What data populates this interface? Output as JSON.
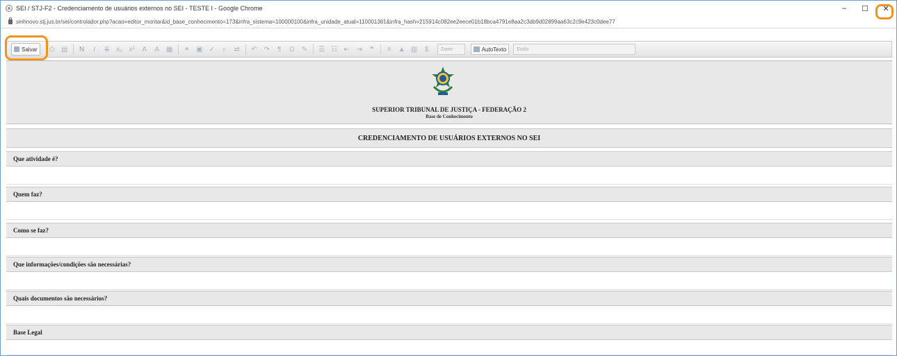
{
  "browser": {
    "title": "SEI / STJ-F2 - Credenciamento de usuários externos no SEI - TESTE I - Google Chrome",
    "url": "seihnovo.stj.jus.br/sei/controlador.php?acao=editor_montar&id_base_conhecimento=173&infra_sistema=100000100&infra_unidade_atual=110001381&infra_hash=215914c082ee2eece01b18bca4791e8aa2c3db9d02899aa63c2c9e423c0dee77",
    "controls": {
      "minimize": "–",
      "maximize": "☐",
      "close": "✕"
    }
  },
  "toolbar": {
    "save_label": "Salvar",
    "zoom_placeholder": "Zoom",
    "autotexto_label": "AutoTexto",
    "style_placeholder": "Estilo"
  },
  "document": {
    "org_name": "SUPERIOR TRIBUNAL DE JUSTIÇA - FEDERAÇÃO 2",
    "org_subtitle": "Base de Conhecimento",
    "title": "CREDENCIAMENTO DE USUÁRIOS EXTERNOS NO SEI",
    "sections": [
      {
        "label": "Que atividade é?"
      },
      {
        "label": "Quem faz?"
      },
      {
        "label": "Como se faz?"
      },
      {
        "label": "Que informações/condições são necessárias?"
      },
      {
        "label": "Quais documentos são necessários?"
      },
      {
        "label": "Base Legal"
      }
    ]
  },
  "highlight_color": "#f0931c"
}
